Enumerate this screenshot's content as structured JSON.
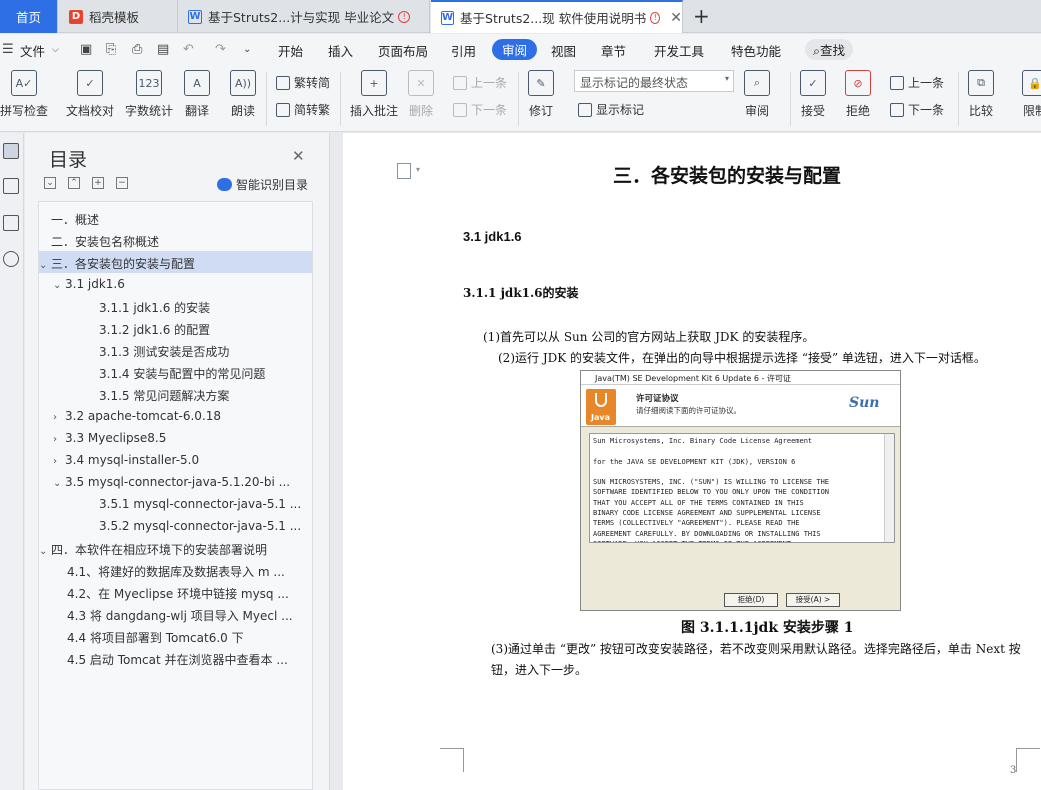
{
  "tabs": [
    {
      "label": "首页"
    },
    {
      "label": "稻壳模板"
    },
    {
      "label": "基于Struts2...计与实现 毕业论文"
    },
    {
      "label": "基于Struts2...现 软件使用说明书"
    }
  ],
  "menu": {
    "file": "文件",
    "items": [
      "开始",
      "插入",
      "页面布局",
      "引用",
      "审阅",
      "视图",
      "章节",
      "开发工具",
      "特色功能"
    ],
    "search": "查找"
  },
  "ribbon": {
    "spellcheck": "拼写检查",
    "doc_proof": "文档校对",
    "word_count": "字数统计",
    "translate": "翻译",
    "read_aloud": "朗读",
    "to_traditional": "简转繁",
    "to_simplified": "繁转简",
    "insert_comment": "插入批注",
    "delete": "删除",
    "prev_comment": "上一条",
    "next_comment": "下一条",
    "track_changes": "修订",
    "markup_state": "显示标记的最终状态",
    "show_markup": "显示标记",
    "review": "审阅",
    "accept": "接受",
    "reject": "拒绝",
    "prev_change": "上一条",
    "next_change": "下一条",
    "compare": "比较",
    "restrict": "限制"
  },
  "toc": {
    "title": "目录",
    "smart_toc": "智能识别目录",
    "items": [
      {
        "label": "一．概述",
        "level": 1,
        "arrow": ""
      },
      {
        "label": "二．安装包名称概述",
        "level": 1,
        "arrow": ""
      },
      {
        "label": "三．各安装包的安装与配置",
        "level": 1,
        "arrow": "v",
        "selected": true
      },
      {
        "label": "3.1    jdk1.6",
        "level": 2,
        "arrow": "v"
      },
      {
        "label": "3.1.1    jdk1.6 的安装",
        "level": 3,
        "arrow": ""
      },
      {
        "label": "3.1.2    jdk1.6 的配置",
        "level": 3,
        "arrow": ""
      },
      {
        "label": "3.1.3    测试安装是否成功",
        "level": 3,
        "arrow": ""
      },
      {
        "label": "3.1.4    安装与配置中的常见问题",
        "level": 3,
        "arrow": ""
      },
      {
        "label": "3.1.5    常见问题解决方案",
        "level": 3,
        "arrow": ""
      },
      {
        "label": "3.2    apache-tomcat-6.0.18",
        "level": 2,
        "arrow": ">"
      },
      {
        "label": "3.3    Myeclipse8.5",
        "level": 2,
        "arrow": ">"
      },
      {
        "label": "3.4 mysql-installer-5.0",
        "level": 2,
        "arrow": ">"
      },
      {
        "label": "3.5 mysql-connector-java-5.1.20-bi ...",
        "level": 2,
        "arrow": "v"
      },
      {
        "label": "3.5.1    mysql-connector-java-5.1 ...",
        "level": 3,
        "arrow": ""
      },
      {
        "label": "3.5.2    mysql-connector-java-5.1 ...",
        "level": 3,
        "arrow": ""
      },
      {
        "label": "四．本软件在相应环境下的安装部署说明",
        "level": 1,
        "arrow": "v"
      },
      {
        "label": "4.1、将建好的数据库及数据表导入 m ...",
        "level": 2,
        "arrow": ""
      },
      {
        "label": "4.2、在 Myeclipse 环境中链接 mysq ...",
        "level": 2,
        "arrow": ""
      },
      {
        "label": "4.3 将 dangdang-wlj 项目导入 Myecl ...",
        "level": 2,
        "arrow": ""
      },
      {
        "label": "4.4 将项目部署到 Tomcat6.0 下",
        "level": 2,
        "arrow": ""
      },
      {
        "label": "4.5 启动 Tomcat 并在浏览器中查看本 ...",
        "level": 2,
        "arrow": ""
      }
    ]
  },
  "doc": {
    "chapter_title": "三．各安装包的安装与配置",
    "section_31": "3.1    jdk1.6",
    "section_311": "3.1.1    jdk1.6的安装",
    "para1": "(1)首先可以从 Sun 公司的官方网站上获取 JDK 的安装程序。",
    "para2": "(2)运行 JDK 的安装文件，在弹出的向导中根据提示选择 “接受” 单选钮，进入下一对话框。",
    "figure_caption": "图 3.1.1.1jdk 安装步骤 1",
    "para3_line1": "(3)通过单击 “更改” 按钮可改变安装路径，若不改变则采用默认路径。选择完路径后，单击 Next 按",
    "para3_line2": "钮，进入下一步。",
    "page_number": "3"
  },
  "dialog": {
    "title": "Java(TM) SE Development Kit 6 Update 6 - 许可证",
    "header_title": "许可证协议",
    "header_sub": "请仔细阅读下面的许可证协议。",
    "java_label": "Java",
    "sun_label": "Sun",
    "license_lines": [
      "Sun Microsystems, Inc. Binary Code License Agreement",
      "",
      "for the JAVA SE DEVELOPMENT KIT (JDK), VERSION 6",
      "",
      "SUN MICROSYSTEMS, INC. (\"SUN\") IS WILLING TO LICENSE THE",
      "SOFTWARE IDENTIFIED BELOW TO YOU ONLY UPON THE CONDITION",
      "THAT YOU ACCEPT ALL OF THE TERMS CONTAINED IN THIS",
      "BINARY CODE LICENSE AGREEMENT AND SUPPLEMENTAL LICENSE",
      "TERMS (COLLECTIVELY \"AGREEMENT\"). PLEASE READ THE",
      "AGREEMENT CAREFULLY. BY DOWNLOADING OR INSTALLING THIS",
      "SOFTWARE, YOU ACCEPT THE TERMS OF THE AGREEMENT."
    ],
    "reject_btn": "拒绝(D)",
    "accept_btn": "接受(A) >"
  },
  "colors": {
    "accent": "#2f6fe6",
    "toc_selected": "#cfdcf3"
  }
}
